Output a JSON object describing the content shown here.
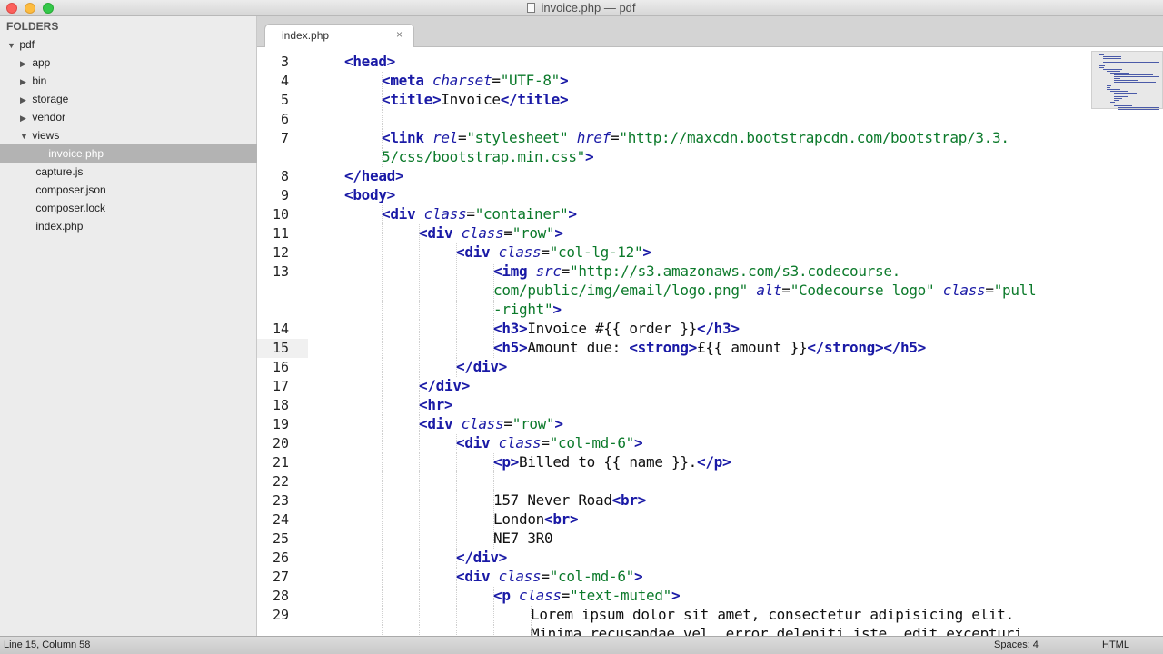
{
  "window": {
    "title": "invoice.php — pdf"
  },
  "sidebar": {
    "header": "FOLDERS",
    "items": [
      {
        "label": "pdf",
        "indent": 0,
        "toggle": "open"
      },
      {
        "label": "app",
        "indent": 1,
        "toggle": "closed"
      },
      {
        "label": "bin",
        "indent": 1,
        "toggle": "closed"
      },
      {
        "label": "storage",
        "indent": 1,
        "toggle": "closed"
      },
      {
        "label": "vendor",
        "indent": 1,
        "toggle": "closed"
      },
      {
        "label": "views",
        "indent": 1,
        "toggle": "open"
      },
      {
        "label": "invoice.php",
        "indent": 2,
        "toggle": "",
        "selected": true
      },
      {
        "label": "capture.js",
        "indent": 1,
        "toggle": ""
      },
      {
        "label": "composer.json",
        "indent": 1,
        "toggle": ""
      },
      {
        "label": "composer.lock",
        "indent": 1,
        "toggle": ""
      },
      {
        "label": "index.php",
        "indent": 1,
        "toggle": ""
      }
    ]
  },
  "tabs": [
    {
      "label": "index.php",
      "close": "×",
      "active": true
    }
  ],
  "editor": {
    "active_line": 15,
    "lines": [
      {
        "n": "3",
        "indent": 1,
        "tokens": [
          [
            "tg",
            "<head>"
          ]
        ]
      },
      {
        "n": "4",
        "indent": 2,
        "tokens": [
          [
            "tg",
            "<meta "
          ],
          [
            "at",
            "charset"
          ],
          [
            "eq",
            "="
          ],
          [
            "st",
            "\"UTF-8\""
          ],
          [
            "tg",
            ">"
          ]
        ]
      },
      {
        "n": "5",
        "indent": 2,
        "tokens": [
          [
            "tg",
            "<title>"
          ],
          [
            "tx",
            "Invoice"
          ],
          [
            "tg",
            "</title>"
          ]
        ]
      },
      {
        "n": "6",
        "indent": 2,
        "tokens": []
      },
      {
        "n": "7",
        "indent": 2,
        "tokens": [
          [
            "tg",
            "<link "
          ],
          [
            "at",
            "rel"
          ],
          [
            "eq",
            "="
          ],
          [
            "st",
            "\"stylesheet\""
          ],
          [
            "tx",
            " "
          ],
          [
            "at",
            "href"
          ],
          [
            "eq",
            "="
          ],
          [
            "st",
            "\"http://maxcdn.bootstrapcdn.com/bootstrap/3.3."
          ]
        ]
      },
      {
        "n": "",
        "indent": 2,
        "tokens": [
          [
            "st",
            "5/css/bootstrap.min.css\""
          ],
          [
            "tg",
            ">"
          ]
        ]
      },
      {
        "n": "8",
        "indent": 1,
        "tokens": [
          [
            "tg",
            "</head>"
          ]
        ]
      },
      {
        "n": "9",
        "indent": 1,
        "tokens": [
          [
            "tg",
            "<body>"
          ]
        ]
      },
      {
        "n": "10",
        "indent": 2,
        "tokens": [
          [
            "tg",
            "<div "
          ],
          [
            "at",
            "class"
          ],
          [
            "eq",
            "="
          ],
          [
            "st",
            "\"container\""
          ],
          [
            "tg",
            ">"
          ]
        ]
      },
      {
        "n": "11",
        "indent": 3,
        "tokens": [
          [
            "tg",
            "<div "
          ],
          [
            "at",
            "class"
          ],
          [
            "eq",
            "="
          ],
          [
            "st",
            "\"row\""
          ],
          [
            "tg",
            ">"
          ]
        ]
      },
      {
        "n": "12",
        "indent": 4,
        "tokens": [
          [
            "tg",
            "<div "
          ],
          [
            "at",
            "class"
          ],
          [
            "eq",
            "="
          ],
          [
            "st",
            "\"col-lg-12\""
          ],
          [
            "tg",
            ">"
          ]
        ]
      },
      {
        "n": "13",
        "indent": 5,
        "tokens": [
          [
            "tg",
            "<img "
          ],
          [
            "at",
            "src"
          ],
          [
            "eq",
            "="
          ],
          [
            "st",
            "\"http://s3.amazonaws.com/s3.codecourse."
          ]
        ]
      },
      {
        "n": "",
        "indent": 5,
        "tokens": [
          [
            "st",
            "com/public/img/email/logo.png\""
          ],
          [
            "tx",
            " "
          ],
          [
            "at",
            "alt"
          ],
          [
            "eq",
            "="
          ],
          [
            "st",
            "\"Codecourse logo\""
          ],
          [
            "tx",
            " "
          ],
          [
            "at",
            "class"
          ],
          [
            "eq",
            "="
          ],
          [
            "st",
            "\"pull"
          ]
        ]
      },
      {
        "n": "",
        "indent": 5,
        "tokens": [
          [
            "st",
            "-right\""
          ],
          [
            "tg",
            ">"
          ]
        ]
      },
      {
        "n": "14",
        "indent": 5,
        "tokens": [
          [
            "tg",
            "<h3>"
          ],
          [
            "tx",
            "Invoice #{{ order }}"
          ],
          [
            "tg",
            "</h3>"
          ]
        ]
      },
      {
        "n": "15",
        "indent": 5,
        "tokens": [
          [
            "tg",
            "<h5>"
          ],
          [
            "tx",
            "Amount due: "
          ],
          [
            "tg",
            "<strong>"
          ],
          [
            "tx",
            "£{{ amount }}"
          ],
          [
            "tg",
            "</strong>"
          ],
          [
            "tg",
            "</h5>"
          ]
        ]
      },
      {
        "n": "16",
        "indent": 4,
        "tokens": [
          [
            "tg",
            "</div>"
          ]
        ]
      },
      {
        "n": "17",
        "indent": 3,
        "tokens": [
          [
            "tg",
            "</div>"
          ]
        ]
      },
      {
        "n": "18",
        "indent": 3,
        "tokens": [
          [
            "tg",
            "<hr>"
          ]
        ]
      },
      {
        "n": "19",
        "indent": 3,
        "tokens": [
          [
            "tg",
            "<div "
          ],
          [
            "at",
            "class"
          ],
          [
            "eq",
            "="
          ],
          [
            "st",
            "\"row\""
          ],
          [
            "tg",
            ">"
          ]
        ]
      },
      {
        "n": "20",
        "indent": 4,
        "tokens": [
          [
            "tg",
            "<div "
          ],
          [
            "at",
            "class"
          ],
          [
            "eq",
            "="
          ],
          [
            "st",
            "\"col-md-6\""
          ],
          [
            "tg",
            ">"
          ]
        ]
      },
      {
        "n": "21",
        "indent": 5,
        "tokens": [
          [
            "tg",
            "<p>"
          ],
          [
            "tx",
            "Billed to {{ name }}."
          ],
          [
            "tg",
            "</p>"
          ]
        ]
      },
      {
        "n": "22",
        "indent": 5,
        "tokens": []
      },
      {
        "n": "23",
        "indent": 5,
        "tokens": [
          [
            "tx",
            "157 Never Road"
          ],
          [
            "tg",
            "<br>"
          ]
        ]
      },
      {
        "n": "24",
        "indent": 5,
        "tokens": [
          [
            "tx",
            "London"
          ],
          [
            "tg",
            "<br>"
          ]
        ]
      },
      {
        "n": "25",
        "indent": 5,
        "tokens": [
          [
            "tx",
            "NE7 3R0"
          ]
        ]
      },
      {
        "n": "26",
        "indent": 4,
        "tokens": [
          [
            "tg",
            "</div>"
          ]
        ]
      },
      {
        "n": "27",
        "indent": 4,
        "tokens": [
          [
            "tg",
            "<div "
          ],
          [
            "at",
            "class"
          ],
          [
            "eq",
            "="
          ],
          [
            "st",
            "\"col-md-6\""
          ],
          [
            "tg",
            ">"
          ]
        ]
      },
      {
        "n": "28",
        "indent": 5,
        "tokens": [
          [
            "tg",
            "<p "
          ],
          [
            "at",
            "class"
          ],
          [
            "eq",
            "="
          ],
          [
            "st",
            "\"text-muted\""
          ],
          [
            "tg",
            ">"
          ]
        ]
      },
      {
        "n": "29",
        "indent": 6,
        "tokens": [
          [
            "tx",
            "Lorem ipsum dolor sit amet, consectetur adipisicing elit."
          ]
        ]
      },
      {
        "n": "",
        "indent": 6,
        "tokens": [
          [
            "tx",
            "Minima recusandae vel, error deleniti iste, edit excepturi"
          ]
        ]
      }
    ]
  },
  "status": {
    "position": "Line 15, Column 58",
    "spaces": "Spaces: 4",
    "syntax": "HTML"
  },
  "colors": {
    "tag": "#1a1aa6",
    "string": "#0c7a2b",
    "sidebar_selected": "#b3b3b3"
  }
}
